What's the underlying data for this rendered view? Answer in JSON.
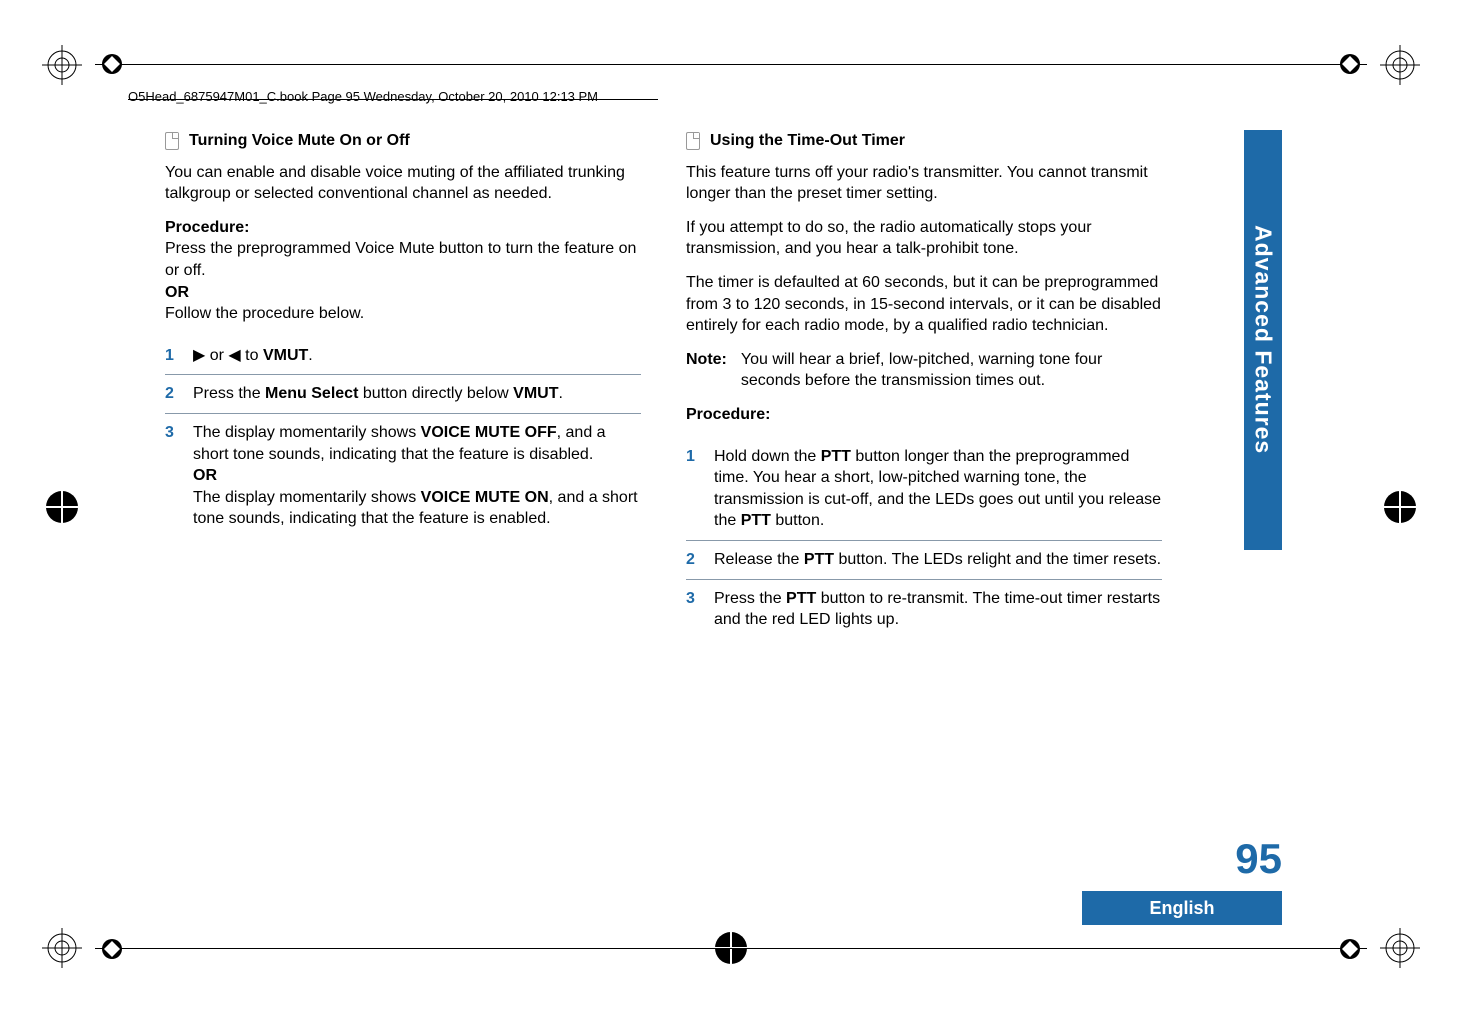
{
  "header": "O5Head_6875947M01_C.book  Page 95  Wednesday, October 20, 2010  12:13 PM",
  "sideTab": "Advanced Features",
  "pageNumber": "95",
  "language": "English",
  "left": {
    "heading": "Turning Voice Mute On or Off",
    "intro": "You can enable and disable voice muting of the affiliated trunking talkgroup or selected conventional channel as needed.",
    "procLabel": "Procedure:",
    "procText1": "Press the preprogrammed Voice Mute button to turn the feature on or off.",
    "or": "OR",
    "procText2": "Follow the procedure below.",
    "steps": [
      {
        "n": "1",
        "pre": "",
        "arrows": "▶ or ◀ to ",
        "ui": "VMUT",
        "post": "."
      },
      {
        "n": "2",
        "pre": "Press the ",
        "bold": "Menu Select",
        "mid": " button directly below ",
        "ui": "VMUT",
        "post": "."
      },
      {
        "n": "3",
        "line1a": "The display momentarily shows ",
        "ui1": "VOICE MUTE OFF",
        "line1b": ", and a short tone sounds, indicating that the feature is disabled.",
        "or": "OR",
        "line2a": "The display momentarily shows ",
        "ui2": "VOICE MUTE ON",
        "line2b": ", and a short tone sounds, indicating that the feature is enabled."
      }
    ]
  },
  "right": {
    "heading": "Using the Time-Out Timer",
    "p1": "This feature turns off your radio's transmitter. You cannot transmit longer than the preset timer setting.",
    "p2": "If you attempt to do so, the radio automatically stops your transmission, and you hear a talk-prohibit tone.",
    "p3": "The timer is defaulted at 60 seconds, but it can be preprogrammed from 3 to 120 seconds, in 15-second intervals, or it can be disabled entirely for each radio mode, by a qualified radio technician.",
    "noteLabel": "Note:",
    "noteText": "You will hear a brief, low-pitched, warning tone four seconds before the transmission times out.",
    "procLabel": "Procedure:",
    "steps": [
      {
        "n": "1",
        "a": "Hold down the ",
        "b1": "PTT",
        "b": " button longer than the preprogrammed time. You hear a short, low-pitched warning tone, the transmission is cut-off, and the LEDs goes out until you release the ",
        "b2": "PTT",
        "c": " button."
      },
      {
        "n": "2",
        "a": "Release the ",
        "b1": "PTT",
        "b": " button. The LEDs relight and the timer resets."
      },
      {
        "n": "3",
        "a": "Press the ",
        "b1": "PTT",
        "b": " button to re-transmit. The time-out timer restarts and the red LED lights up."
      }
    ]
  }
}
